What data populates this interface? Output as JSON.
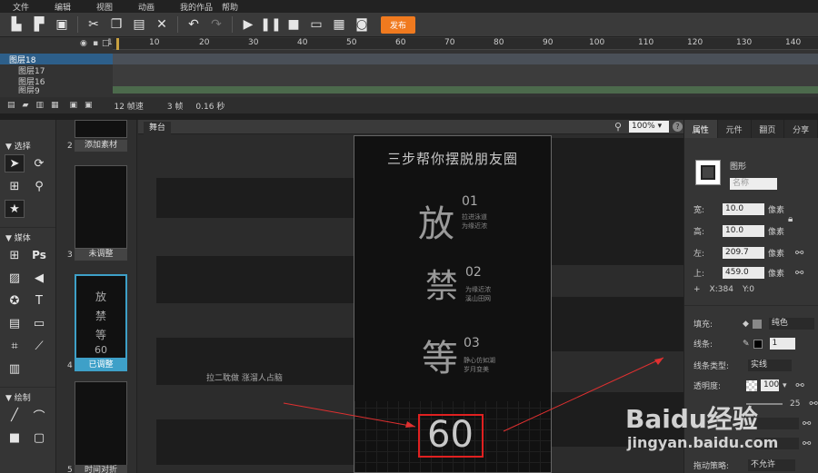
{
  "menu": [
    "文件",
    "编辑",
    "视图",
    "动画",
    "我的作品",
    "帮助"
  ],
  "toolbar": {
    "publish_label": "发布"
  },
  "timeline": {
    "ruler": [
      "1",
      "10",
      "20",
      "30",
      "40",
      "50",
      "60",
      "70",
      "80",
      "90",
      "100",
      "110",
      "120",
      "130",
      "140"
    ],
    "layers": [
      "图层18",
      "图层17",
      "图层16",
      "图层9"
    ],
    "status": {
      "fps": "12 帧速",
      "frames": "3 帧",
      "seconds": "0.16 秒"
    }
  },
  "tools": {
    "sections": [
      "选择",
      "媒体",
      "绘制"
    ]
  },
  "pages": [
    {
      "num": "2",
      "label": "添加素材"
    },
    {
      "num": "3",
      "label": "未调整"
    },
    {
      "num": "4",
      "label": "已调整"
    },
    {
      "num": "5",
      "label": "时间对折"
    }
  ],
  "stage": {
    "tab": "舞台",
    "zoom": "100%",
    "phone": {
      "title": "三步帮你摆脱朋友圈",
      "chars": [
        "放",
        "禁",
        "等"
      ],
      "nums": [
        "01",
        "02",
        "03"
      ],
      "notes": [
        [
          "拉进泳道",
          "为缘近浓"
        ],
        [
          "为缘近浓",
          "溪山田网"
        ],
        [
          "静心仿如湖",
          "岁月变美"
        ]
      ],
      "counter": "60"
    },
    "left_text": "拉二耽做 涨溜人占脑"
  },
  "props": {
    "tabs": [
      "属性",
      "元件",
      "翻页",
      "分享"
    ],
    "shape": "图形",
    "name_placeholder": "名称",
    "width_label": "宽:",
    "width": "10.0",
    "unit": "像素",
    "height_label": "高:",
    "height": "10.0",
    "left_label": "左:",
    "left": "209.7",
    "top_label": "上:",
    "top": "459.0",
    "x": "X:384",
    "y": "Y:0",
    "fill_label": "填充:",
    "fill_type": "纯色",
    "stroke_label": "线条:",
    "stroke_value": "1",
    "stroke_type_label": "线条类型:",
    "stroke_type": "实线",
    "opacity_label": "透明度:",
    "opacity": "100",
    "radius_value": "25",
    "drag_label": "拖动策略:",
    "drag_value": "不允许"
  },
  "watermark": {
    "brand": "Baidu经验",
    "url": "jingyan.baidu.com"
  }
}
